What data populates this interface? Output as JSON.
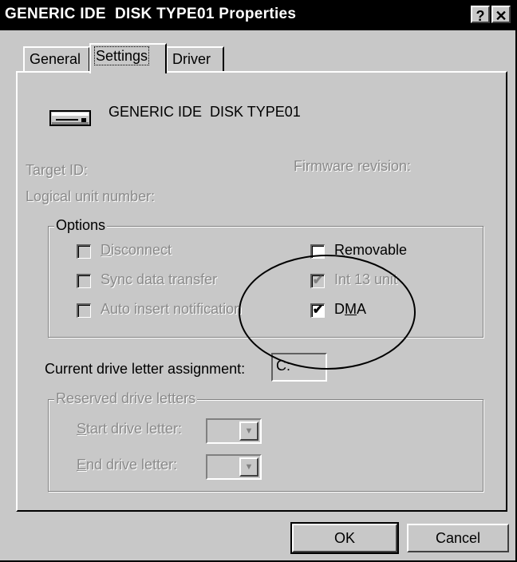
{
  "window": {
    "title": "GENERIC IDE  DISK TYPE01 Properties",
    "help_glyph": "?",
    "close_glyph": "✕"
  },
  "tabs": [
    {
      "label": "General",
      "active": false
    },
    {
      "label": "Settings",
      "active": true
    },
    {
      "label": "Driver",
      "active": false
    }
  ],
  "device": {
    "icon": "disk-drive-icon",
    "name": "GENERIC IDE  DISK TYPE01"
  },
  "info": {
    "target_id_label": "Target ID:",
    "firmware_label": "Firmware revision:",
    "lun_label": "Logical unit number:"
  },
  "options": {
    "legend": "Options",
    "disconnect": {
      "label": "Disconnect",
      "checked": false,
      "enabled": false
    },
    "sync_data_transfer": {
      "label": "Sync data transfer",
      "checked": false,
      "enabled": false
    },
    "auto_insert_notification": {
      "label": "Auto insert notification",
      "checked": false,
      "enabled": false
    },
    "removable": {
      "label": "Removable",
      "checked": false,
      "enabled": true
    },
    "int13_unit": {
      "label": "Int 13 unit",
      "checked": true,
      "enabled": false
    },
    "dma": {
      "label": "DMA",
      "checked": true,
      "enabled": true
    }
  },
  "drive_letter": {
    "label": "Current drive letter assignment:",
    "value": "C:"
  },
  "reserved": {
    "legend": "Reserved drive letters",
    "start_label": "Start drive letter:",
    "end_label": "End drive letter:",
    "start_value": "",
    "end_value": ""
  },
  "buttons": {
    "ok": "OK",
    "cancel": "Cancel"
  },
  "check_glyph": "✔",
  "dropdown_glyph": "▼",
  "colors": {
    "face": "#c8c8c8",
    "title_bg": "#000000",
    "disabled_text": "#8a8a8a"
  }
}
